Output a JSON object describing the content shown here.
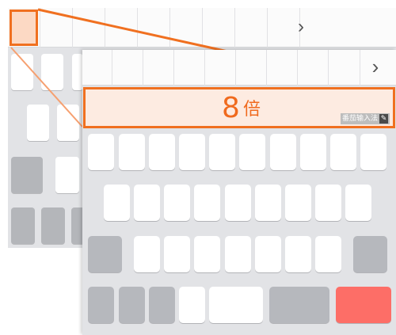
{
  "composition": {
    "number": "8",
    "character": "倍"
  },
  "branding": {
    "label": "番茄输入法",
    "icon": "pen-icon"
  },
  "candidate_bar": {
    "more_label": "›"
  },
  "colors": {
    "accent": "#f07020",
    "highlight_fill": "#fdebe1",
    "keyboard_bg": "#e2e3e6",
    "key": "#ffffff",
    "function_key": "#b6b8bd",
    "action_key": "#fd6e67"
  }
}
